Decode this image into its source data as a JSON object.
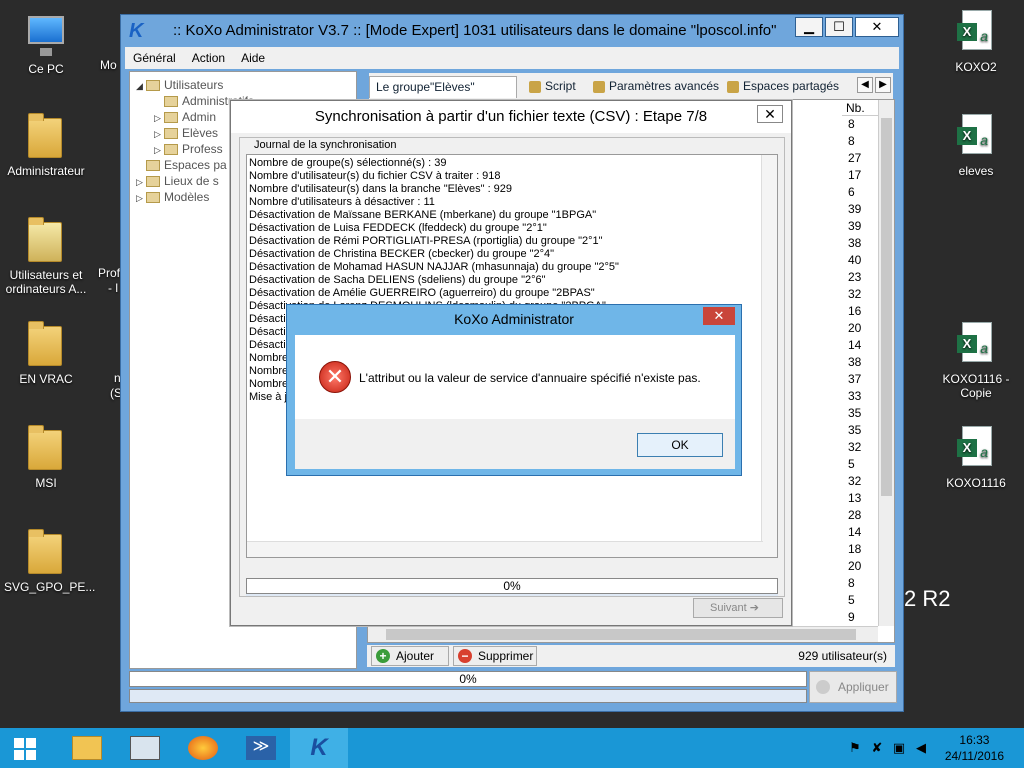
{
  "desktop": {
    "left_icons": [
      {
        "label": "Ce PC"
      },
      {
        "label": "Administrateur"
      },
      {
        "label": "Utilisateurs et ordinateurs A..."
      },
      {
        "label": "EN VRAC"
      },
      {
        "label": "MSI"
      },
      {
        "label": "SVG_GPO_PE..."
      }
    ],
    "partial_labels": [
      "Mo",
      "Prof",
      "- l",
      "n",
      "(S"
    ],
    "right_icons": [
      {
        "label": "KOXO2"
      },
      {
        "label": "eleves"
      },
      {
        "label": "KOXO1116 - Copie"
      },
      {
        "label": "KOXO1116"
      }
    ],
    "watermark": "2 R2"
  },
  "main_window": {
    "title": ":: KoXo Administrator V3.7 :: [Mode Expert] 1031 utilisateurs dans le domaine \"lposcol.info\"",
    "menu": [
      "Général",
      "Action",
      "Aide"
    ],
    "tree": [
      {
        "label": "Utilisateurs",
        "expander": "◢"
      },
      {
        "label": "Administratifs",
        "expander": ""
      },
      {
        "label": "Admin",
        "expander": "▷"
      },
      {
        "label": "Elèves",
        "expander": "▷"
      },
      {
        "label": "Profess",
        "expander": "▷"
      },
      {
        "label": "Espaces pa",
        "expander": ""
      },
      {
        "label": "Lieux de s",
        "expander": "▷"
      },
      {
        "label": "Modèles",
        "expander": "▷"
      }
    ],
    "tabs": [
      "Le groupe\"Elèves\" contient",
      "Script",
      "Paramètres avancés",
      "Espaces partagés"
    ],
    "nb_header": "Nb.",
    "nb_values": [
      "8",
      "8",
      "27",
      "17",
      "6",
      "39",
      "39",
      "38",
      "40",
      "23",
      "32",
      "16",
      "20",
      "14",
      "38",
      "37",
      "33",
      "35",
      "35",
      "32",
      "5",
      "32",
      "13",
      "28",
      "14",
      "18",
      "20",
      "8",
      "5",
      "9"
    ],
    "add_label": "Ajouter",
    "delete_label": "Supprimer",
    "user_count": "929 utilisateur(s)",
    "progress_label": "0%",
    "apply_label": "Appliquer"
  },
  "sync_dialog": {
    "title": "Synchronisation à partir d'un fichier texte (CSV) : Etape 7/8",
    "group_label": "Journal de la synchronisation",
    "log": [
      "Nombre de groupe(s) sélectionné(s) : 39",
      "Nombre d'utilisateur(s) du fichier CSV à traiter : 918",
      "Nombre d'utilisateur(s) dans la branche \"Elèves\" : 929",
      "Nombre d'utilisateurs à désactiver : 11",
      "Désactivation de Maïssane BERKANE (mberkane) du groupe \"1BPGA\"",
      "Désactivation de Luisa FEDDECK (lfeddeck) du groupe \"2°1\"",
      "Désactivation de Rémi PORTIGLIATI-PRESA (rportiglia) du groupe \"2°1\"",
      "Désactivation de Christina BECKER (cbecker) du groupe \"2°4\"",
      "Désactivation de Mohamad HASUN NAJJAR (mhasunnaja) du groupe \"2°5\"",
      "Désactivation de Sacha DELIENS (sdeliens) du groupe \"2°6\"",
      "Désactivation de Amélie GUERREIRO (aguerreiro) du groupe \"2BPAS\"",
      "Désactivation de Lorenz DESMOULINS (ldesmoulin) du groupe \"2BPGA\"",
      "Désacti",
      "Désacti",
      "Désacti",
      "Nombre",
      "Nombre",
      "Nombre",
      "Mise à jo"
    ],
    "progress_label": "0%",
    "next_label": "Suivant"
  },
  "error_dialog": {
    "title": "KoXo Administrator",
    "message": "L'attribut ou la valeur de service d'annuaire spécifié n'existe pas.",
    "ok_label": "OK"
  },
  "taskbar": {
    "time": "16:33",
    "date": "24/11/2016"
  },
  "colors": {
    "window_frame": "#6fa6dc",
    "taskbar": "#1a97d6",
    "error_frame": "#6fb6e8",
    "error_close": "#c9453a",
    "error_icon": "#c41f10"
  }
}
